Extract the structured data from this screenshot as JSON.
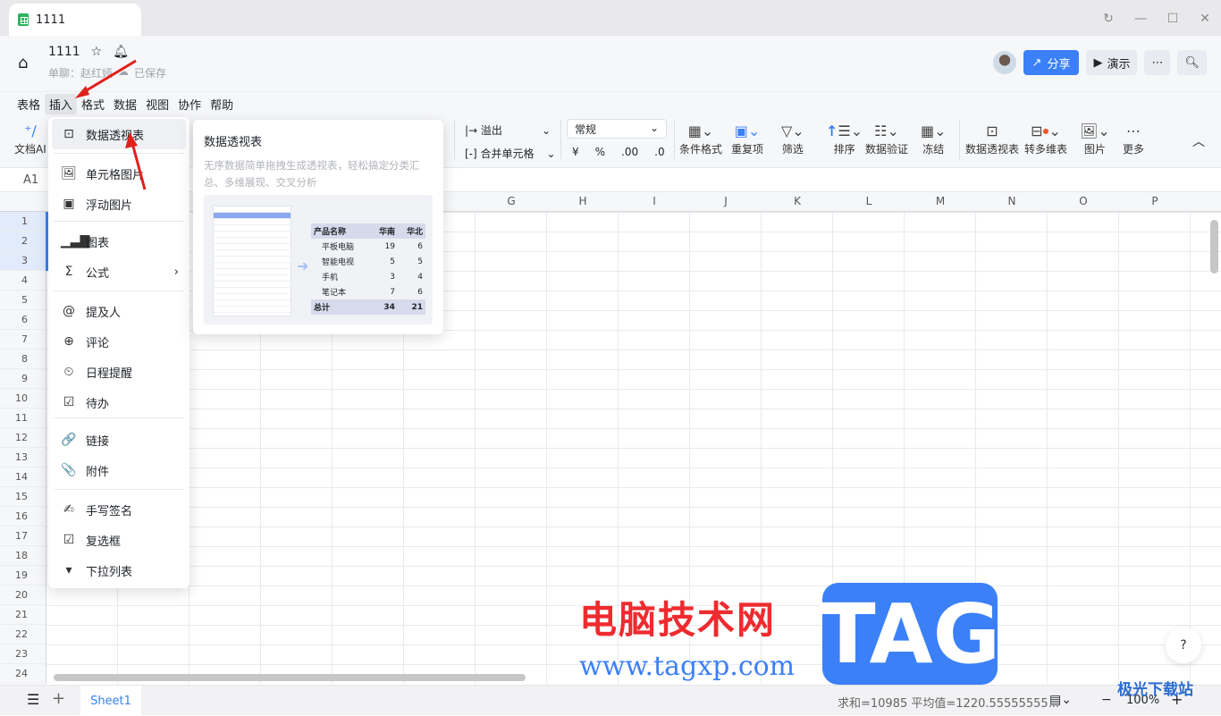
{
  "window": {
    "tab_title": "1111",
    "controls": [
      "↻",
      "—",
      "☐",
      "✕"
    ]
  },
  "header": {
    "doc_title": "1111",
    "subtitle_chat": "单聊：赵红娅",
    "save_status": "已保存",
    "share_label": "分享",
    "present_label": "演示",
    "more_label": "⋯"
  },
  "menubar": [
    "表格",
    "插入",
    "格式",
    "数据",
    "视图",
    "协作",
    "帮助"
  ],
  "toolbar": {
    "ai": "文档AI",
    "overflow": "溢出",
    "merge": "合并单元格",
    "format_value": "常规",
    "currency": "¥",
    "percent": "%",
    "dec_inc": ".00",
    "dec_dec": ".0",
    "items": [
      "条件格式",
      "重复项",
      "筛选",
      "排序",
      "数据验证",
      "冻结",
      "数据透视表",
      "转多维表",
      "图片",
      "更多"
    ]
  },
  "formula_bar": {
    "cell_ref": "A1"
  },
  "columns": [
    "G",
    "H",
    "I",
    "J",
    "K",
    "L",
    "M",
    "N",
    "O",
    "P"
  ],
  "rows": [
    "1",
    "2",
    "3",
    "4",
    "5",
    "6",
    "7",
    "8",
    "9",
    "10",
    "11",
    "12",
    "13",
    "14",
    "15",
    "16",
    "17",
    "18",
    "19",
    "20",
    "21",
    "22",
    "23",
    "24"
  ],
  "insert_menu": {
    "items": [
      {
        "label": "数据透视表",
        "icon": "⊡"
      },
      {
        "label": "单元格图片",
        "icon": "🖼"
      },
      {
        "label": "浮动图片",
        "icon": "▣"
      },
      {
        "label": "图表",
        "icon": "▁▃▇"
      },
      {
        "label": "公式",
        "icon": "Σ",
        "submenu": "›"
      },
      {
        "label": "提及人",
        "icon": "@"
      },
      {
        "label": "评论",
        "icon": "⊕"
      },
      {
        "label": "日程提醒",
        "icon": "⏲"
      },
      {
        "label": "待办",
        "icon": "☑"
      },
      {
        "label": "链接",
        "icon": "🔗"
      },
      {
        "label": "附件",
        "icon": "📎"
      },
      {
        "label": "手写签名",
        "icon": "✍"
      },
      {
        "label": "复选框",
        "icon": "☑"
      },
      {
        "label": "下拉列表",
        "icon": "▾"
      }
    ]
  },
  "tooltip": {
    "title": "数据透视表",
    "description": "无序数据简单拖拽生成透视表，轻松搞定分类汇总、多维展现、交叉分析",
    "pivot": {
      "headers": [
        "产品名称",
        "华南",
        "华北"
      ],
      "rows": [
        [
          "平板电脑",
          "19",
          "6"
        ],
        [
          "智能电视",
          "5",
          "5"
        ],
        [
          "手机",
          "3",
          "4"
        ],
        [
          "笔记本",
          "7",
          "6"
        ]
      ],
      "total": [
        "总计",
        "34",
        "21"
      ]
    }
  },
  "bottom": {
    "sheet_tab": "Sheet1",
    "status": "求和=10985 平均值=1220.55555555...",
    "zoom": "100%"
  },
  "watermark": {
    "cn": "电脑技术网",
    "url": "www.tagxp.com",
    "tag": "TAG",
    "site2": "极光下载站"
  }
}
